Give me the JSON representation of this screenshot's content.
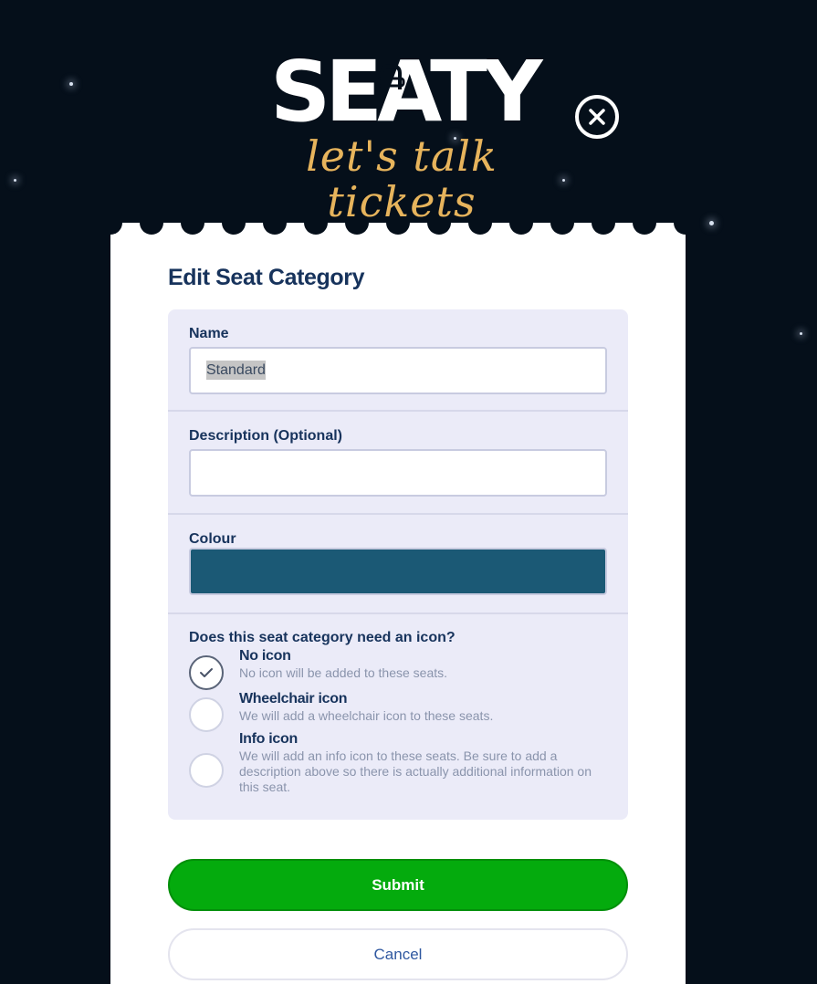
{
  "brand": {
    "logo_text": "SEATY",
    "tagline": "let's talk tickets",
    "tagline_color": "#e7b45c",
    "logo_icon": "seat-icon"
  },
  "header": {
    "close_icon": "close-icon"
  },
  "form": {
    "title": "Edit Seat Category",
    "name": {
      "label": "Name",
      "value": "Standard"
    },
    "description": {
      "label": "Description (Optional)",
      "value": ""
    },
    "colour": {
      "label": "Colour",
      "value": "#1b5975"
    },
    "icon_choice": {
      "question": "Does this seat category need an icon?",
      "selected": "no-icon",
      "options": [
        {
          "id": "no-icon",
          "title": "No icon",
          "description": "No icon will be added to these seats."
        },
        {
          "id": "wheelchair-icon",
          "title": "Wheelchair icon",
          "description": "We will add a wheelchair icon to these seats."
        },
        {
          "id": "info-icon",
          "title": "Info icon",
          "description": "We will add an info icon to these seats. Be sure to add a description above so there is actually additional information on this seat."
        }
      ]
    },
    "submit_label": "Submit",
    "cancel_label": "Cancel"
  },
  "colors": {
    "background": "#050f1a",
    "title_text": "#17335c",
    "panel_background": "#ebebf8",
    "submit_green": "#04ab0d",
    "cancel_text": "#2f58a0"
  }
}
